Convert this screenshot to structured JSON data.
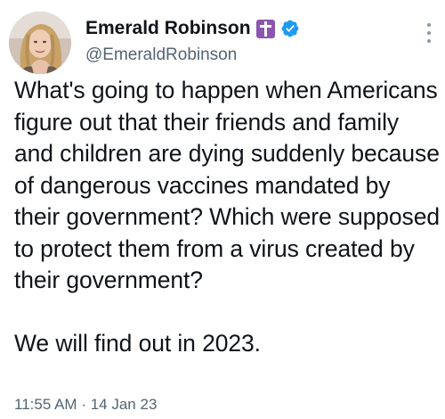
{
  "author": {
    "display_name": "Emerald Robinson",
    "handle": "@EmeraldRobinson",
    "badge_icon": "cross-icon",
    "badge_color": "#8c55b0",
    "verified_icon": "verified-badge-icon",
    "verified_color": "#1d9bf0"
  },
  "tweet": {
    "text": "What's going to happen when Americans figure out that their friends and family and children are dying suddenly because of dangerous vaccines mandated by their government? Which were supposed to protect them from a virus created by their government?\n\nWe will find out in 2023.",
    "time": "11:55 AM",
    "separator": "·",
    "date": "14 Jan 23"
  },
  "menu": {
    "icon": "more-options-icon"
  }
}
